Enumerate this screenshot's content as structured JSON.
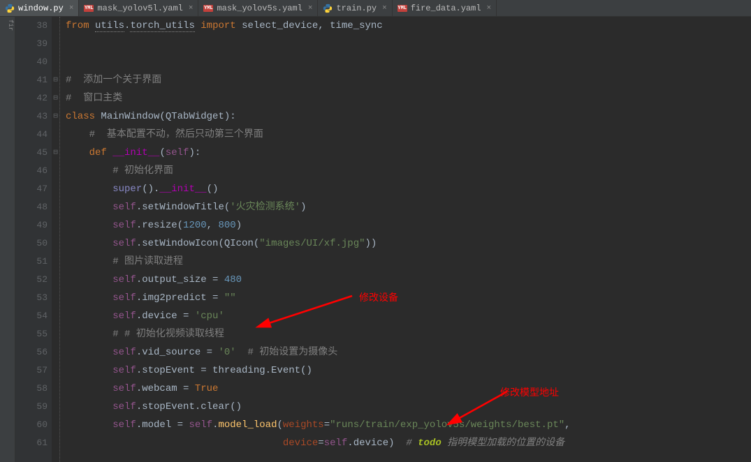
{
  "tabs": [
    {
      "label": "window.py",
      "icon": "py",
      "active": true
    },
    {
      "label": "mask_yolov5l.yaml",
      "icon": "yml",
      "active": false
    },
    {
      "label": "mask_yolov5s.yaml",
      "icon": "yml",
      "active": false
    },
    {
      "label": "train.py",
      "icon": "py",
      "active": false
    },
    {
      "label": "fire_data.yaml",
      "icon": "yml",
      "active": false
    }
  ],
  "sidebar_label": "fir",
  "close_glyph": "×",
  "yml_glyph": "YML",
  "first_line_number": 38,
  "annotations": {
    "device_label": "修改设备",
    "weights_label": "修改模型地址"
  },
  "code": [
    {
      "n": 38,
      "fold": "",
      "parts": [
        {
          "c": "kw",
          "t": "from "
        },
        {
          "c": "underl",
          "t": "utils"
        },
        {
          "c": "",
          "t": "."
        },
        {
          "c": "underl",
          "t": "torch_utils"
        },
        {
          "c": "kw",
          "t": " import "
        },
        {
          "c": "",
          "t": "select_device, time_sync"
        }
      ]
    },
    {
      "n": 39,
      "fold": "",
      "parts": []
    },
    {
      "n": 40,
      "fold": "",
      "parts": []
    },
    {
      "n": 41,
      "fold": "⊟",
      "parts": [
        {
          "c": "comment",
          "t": "#  添加一个关于界面"
        }
      ]
    },
    {
      "n": 42,
      "fold": "⊟",
      "parts": [
        {
          "c": "comment",
          "t": "#  窗口主类"
        }
      ]
    },
    {
      "n": 43,
      "fold": "⊟",
      "parts": [
        {
          "c": "kw",
          "t": "class "
        },
        {
          "c": "",
          "t": "MainWindow(QTabWidget):"
        }
      ]
    },
    {
      "n": 44,
      "fold": "",
      "parts": [
        {
          "c": "",
          "t": "    "
        },
        {
          "c": "comment",
          "t": "#  基本配置不动，然后只动第三个界面"
        }
      ]
    },
    {
      "n": 45,
      "fold": "⊟",
      "parts": [
        {
          "c": "",
          "t": "    "
        },
        {
          "c": "kw",
          "t": "def "
        },
        {
          "c": "magic",
          "t": "__init__"
        },
        {
          "c": "",
          "t": "("
        },
        {
          "c": "self",
          "t": "self"
        },
        {
          "c": "",
          "t": "):"
        }
      ]
    },
    {
      "n": 46,
      "fold": "",
      "parts": [
        {
          "c": "",
          "t": "        "
        },
        {
          "c": "comment",
          "t": "# 初始化界面"
        }
      ]
    },
    {
      "n": 47,
      "fold": "",
      "parts": [
        {
          "c": "",
          "t": "        "
        },
        {
          "c": "builtin",
          "t": "super"
        },
        {
          "c": "",
          "t": "()."
        },
        {
          "c": "magic",
          "t": "__init__"
        },
        {
          "c": "",
          "t": "()"
        }
      ]
    },
    {
      "n": 48,
      "fold": "",
      "parts": [
        {
          "c": "",
          "t": "        "
        },
        {
          "c": "self",
          "t": "self"
        },
        {
          "c": "",
          "t": ".setWindowTitle("
        },
        {
          "c": "str",
          "t": "'火灾检测系统'"
        },
        {
          "c": "",
          "t": ")"
        }
      ]
    },
    {
      "n": 49,
      "fold": "",
      "parts": [
        {
          "c": "",
          "t": "        "
        },
        {
          "c": "self",
          "t": "self"
        },
        {
          "c": "",
          "t": ".resize("
        },
        {
          "c": "num",
          "t": "1200"
        },
        {
          "c": "",
          "t": ", "
        },
        {
          "c": "num",
          "t": "800"
        },
        {
          "c": "",
          "t": ")"
        }
      ]
    },
    {
      "n": 50,
      "fold": "",
      "parts": [
        {
          "c": "",
          "t": "        "
        },
        {
          "c": "self",
          "t": "self"
        },
        {
          "c": "",
          "t": ".setWindowIcon(QIcon("
        },
        {
          "c": "str",
          "t": "\"images/UI/xf.jpg\""
        },
        {
          "c": "",
          "t": "))"
        }
      ]
    },
    {
      "n": 51,
      "fold": "",
      "parts": [
        {
          "c": "",
          "t": "        "
        },
        {
          "c": "comment",
          "t": "# 图片读取进程"
        }
      ]
    },
    {
      "n": 52,
      "fold": "",
      "parts": [
        {
          "c": "",
          "t": "        "
        },
        {
          "c": "self",
          "t": "self"
        },
        {
          "c": "",
          "t": ".output_size = "
        },
        {
          "c": "num",
          "t": "480"
        }
      ]
    },
    {
      "n": 53,
      "fold": "",
      "parts": [
        {
          "c": "",
          "t": "        "
        },
        {
          "c": "self",
          "t": "self"
        },
        {
          "c": "",
          "t": ".img2predict = "
        },
        {
          "c": "str",
          "t": "\"\""
        }
      ]
    },
    {
      "n": 54,
      "fold": "",
      "parts": [
        {
          "c": "",
          "t": "        "
        },
        {
          "c": "self",
          "t": "self"
        },
        {
          "c": "",
          "t": ".device = "
        },
        {
          "c": "str",
          "t": "'cpu'"
        }
      ]
    },
    {
      "n": 55,
      "fold": "",
      "parts": [
        {
          "c": "",
          "t": "        "
        },
        {
          "c": "comment",
          "t": "# # 初始化视频读取线程"
        }
      ]
    },
    {
      "n": 56,
      "fold": "",
      "parts": [
        {
          "c": "",
          "t": "        "
        },
        {
          "c": "self",
          "t": "self"
        },
        {
          "c": "",
          "t": ".vid_source = "
        },
        {
          "c": "str",
          "t": "'0'"
        },
        {
          "c": "",
          "t": "  "
        },
        {
          "c": "comment",
          "t": "# 初始设置为摄像头"
        }
      ]
    },
    {
      "n": 57,
      "fold": "",
      "parts": [
        {
          "c": "",
          "t": "        "
        },
        {
          "c": "self",
          "t": "self"
        },
        {
          "c": "",
          "t": ".stopEvent = threading.Event()"
        }
      ]
    },
    {
      "n": 58,
      "fold": "",
      "parts": [
        {
          "c": "",
          "t": "        "
        },
        {
          "c": "self",
          "t": "self"
        },
        {
          "c": "",
          "t": ".webcam = "
        },
        {
          "c": "kw",
          "t": "True"
        }
      ]
    },
    {
      "n": 59,
      "fold": "",
      "parts": [
        {
          "c": "",
          "t": "        "
        },
        {
          "c": "self",
          "t": "self"
        },
        {
          "c": "",
          "t": ".stopEvent.clear()"
        }
      ]
    },
    {
      "n": 60,
      "fold": "",
      "parts": [
        {
          "c": "",
          "t": "        "
        },
        {
          "c": "self",
          "t": "self"
        },
        {
          "c": "",
          "t": ".model = "
        },
        {
          "c": "self",
          "t": "self"
        },
        {
          "c": "",
          "t": "."
        },
        {
          "c": "fn",
          "t": "model_load"
        },
        {
          "c": "",
          "t": "("
        },
        {
          "c": "param",
          "t": "weights"
        },
        {
          "c": "",
          "t": "="
        },
        {
          "c": "str",
          "t": "\"runs/train/exp_yolov5s/weights/best.pt\""
        },
        {
          "c": "",
          "t": ","
        }
      ]
    },
    {
      "n": 61,
      "fold": "",
      "parts": [
        {
          "c": "",
          "t": "                                     "
        },
        {
          "c": "param",
          "t": "device"
        },
        {
          "c": "",
          "t": "="
        },
        {
          "c": "self",
          "t": "self"
        },
        {
          "c": "",
          "t": ".device)  "
        },
        {
          "c": "paramic",
          "t": "# "
        },
        {
          "c": "todo",
          "t": "todo"
        },
        {
          "c": "tododesc",
          "t": " 指明模型加载的位置的设备"
        }
      ]
    }
  ]
}
